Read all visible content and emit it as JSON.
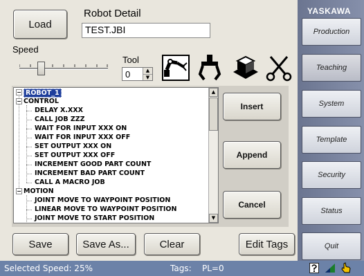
{
  "header": {
    "load_label": "Load",
    "robot_detail_label": "Robot Detail",
    "job_name": "TEST.JBI"
  },
  "speed": {
    "label": "Speed",
    "value_percent": 25
  },
  "tool": {
    "label": "Tool",
    "value": "0"
  },
  "tool_icons": [
    "robot-arm-icon",
    "gripper-icon",
    "conveyor-icon",
    "scissors-icon"
  ],
  "tree": {
    "root": "ROBOT_1",
    "groups": [
      {
        "label": "CONTROL",
        "items": [
          "DELAY X.XXX",
          "CALL JOB ZZZ",
          "WAIT FOR INPUT XXX ON",
          "WAIT FOR INPUT XXX OFF",
          "SET OUTPUT XXX ON",
          "SET OUTPUT XXX OFF",
          "INCREMENT GOOD PART COUNT",
          "INCREMENT BAD PART COUNT",
          "CALL A MACRO JOB"
        ]
      },
      {
        "label": "MOTION",
        "items": [
          "JOINT MOVE TO WAYPOINT POSITION",
          "LINEAR MOVE TO WAYPOINT POSITION",
          "JOINT MOVE TO START POSITION"
        ]
      }
    ]
  },
  "actions": {
    "insert": "Insert",
    "append": "Append",
    "cancel": "Cancel"
  },
  "bottom": {
    "save": "Save",
    "save_as": "Save As...",
    "clear": "Clear",
    "edit_tags": "Edit Tags"
  },
  "sidebar": {
    "brand": "YASKAWA",
    "items": [
      "Production",
      "Teaching",
      "System",
      "Template",
      "Security",
      "Status",
      "Quit"
    ],
    "active": "Teaching"
  },
  "status": {
    "speed_text": "Selected Speed: 25%",
    "tags_text": "Tags:",
    "pl_text": "PL=0"
  },
  "colors": {
    "statusbar": "#6c82a8",
    "sidebar": "#7a84a0",
    "selection": "#1f3f9c"
  }
}
